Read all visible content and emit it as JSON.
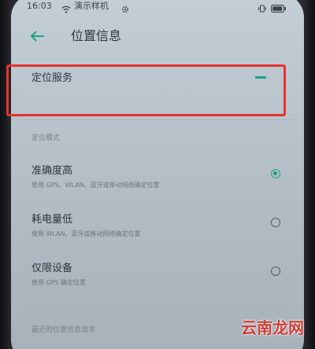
{
  "status_bar": {
    "time": "16:03",
    "title": "演示样机"
  },
  "header": {
    "title": "位置信息"
  },
  "location_service": {
    "label": "定位服务",
    "enabled": false
  },
  "location_mode": {
    "section_label": "定位模式",
    "options": [
      {
        "title": "准确度高",
        "description": "使用 GPS、WLAN、蓝牙或移动网络确定位置",
        "selected": true
      },
      {
        "title": "耗电量低",
        "description": "使用 WLAN、蓝牙或移动网络确定位置",
        "selected": false
      },
      {
        "title": "仅限设备",
        "description": "使用 GPS 确定位置",
        "selected": false
      }
    ]
  },
  "recent_requests": {
    "section_label": "最近的位置信息请求"
  },
  "watermark": {
    "text": "云南龙网"
  },
  "colors": {
    "accent": "#1aa678",
    "highlight": "#e6332e"
  }
}
